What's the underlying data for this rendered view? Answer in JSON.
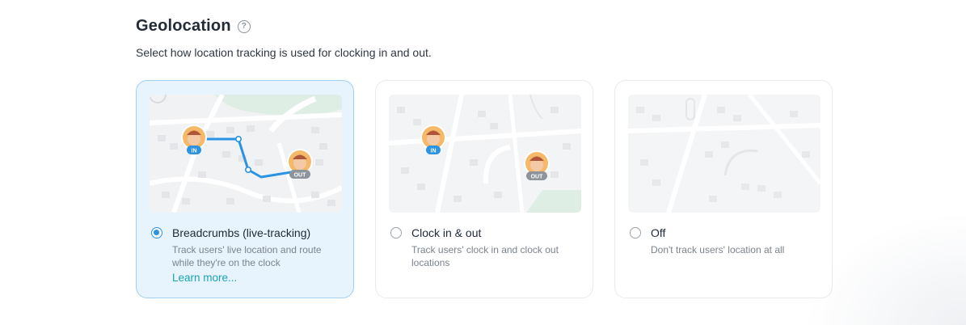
{
  "section": {
    "title": "Geolocation",
    "subtitle": "Select how location tracking is used for clocking in and out."
  },
  "options": [
    {
      "label": "Breadcrumbs (live-tracking)",
      "description": "Track users' live location and route while they're on the clock",
      "link": "Learn more...",
      "selected": true,
      "markers": [
        "IN",
        "OUT"
      ]
    },
    {
      "label": "Clock in & out",
      "description": "Track users' clock in and clock out locations",
      "selected": false,
      "markers": [
        "IN",
        "OUT"
      ]
    },
    {
      "label": "Off",
      "description": "Don't track users' location at all",
      "selected": false
    }
  ],
  "colors": {
    "accent": "#2a93e4",
    "selected_bg": "#e8f4fd",
    "link": "#1aa4b6",
    "in_badge": "#2a93e4",
    "out_badge": "#8d949c"
  },
  "icons": {
    "help": "question-circle-icon",
    "avatar": "user-avatar-icon"
  }
}
